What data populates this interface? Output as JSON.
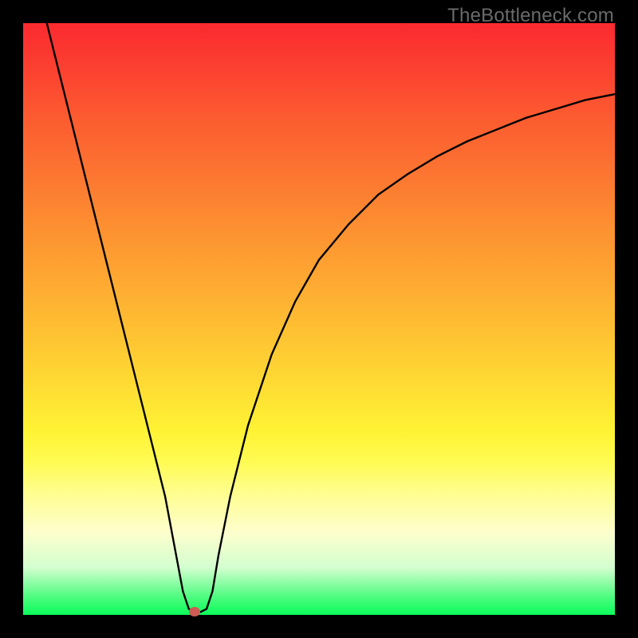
{
  "attribution": "TheBottleneck.com",
  "chart_data": {
    "type": "line",
    "title": "",
    "xlabel": "",
    "ylabel": "",
    "xlim": [
      0,
      100
    ],
    "ylim": [
      0,
      100
    ],
    "series": [
      {
        "name": "bottleneck-curve",
        "x": [
          4,
          6,
          8,
          10,
          12,
          14,
          16,
          18,
          20,
          22,
          24,
          25.5,
          27,
          28,
          29,
          30,
          31,
          32,
          33,
          35,
          38,
          42,
          46,
          50,
          55,
          60,
          65,
          70,
          75,
          80,
          85,
          90,
          95,
          100
        ],
        "y": [
          100,
          92,
          84,
          76,
          68,
          60,
          52,
          44,
          36,
          28,
          20,
          12,
          4,
          1,
          0.5,
          0.5,
          1,
          4,
          10,
          20,
          32,
          44,
          53,
          60,
          66,
          71,
          74.5,
          77.5,
          80,
          82,
          84,
          85.5,
          87,
          88
        ]
      }
    ],
    "annotations": [
      {
        "name": "min-point-marker",
        "x": 29,
        "y": 0.5,
        "color": "#cd5c55"
      }
    ],
    "background": {
      "type": "vertical-gradient",
      "stops": [
        {
          "pos": 0,
          "color": "#fb2a2f"
        },
        {
          "pos": 50,
          "color": "#fec233"
        },
        {
          "pos": 75,
          "color": "#fffb60"
        },
        {
          "pos": 100,
          "color": "#0afb5b"
        }
      ]
    }
  },
  "layout": {
    "image_size": 800,
    "plot_offset": 29,
    "plot_size": 742
  }
}
